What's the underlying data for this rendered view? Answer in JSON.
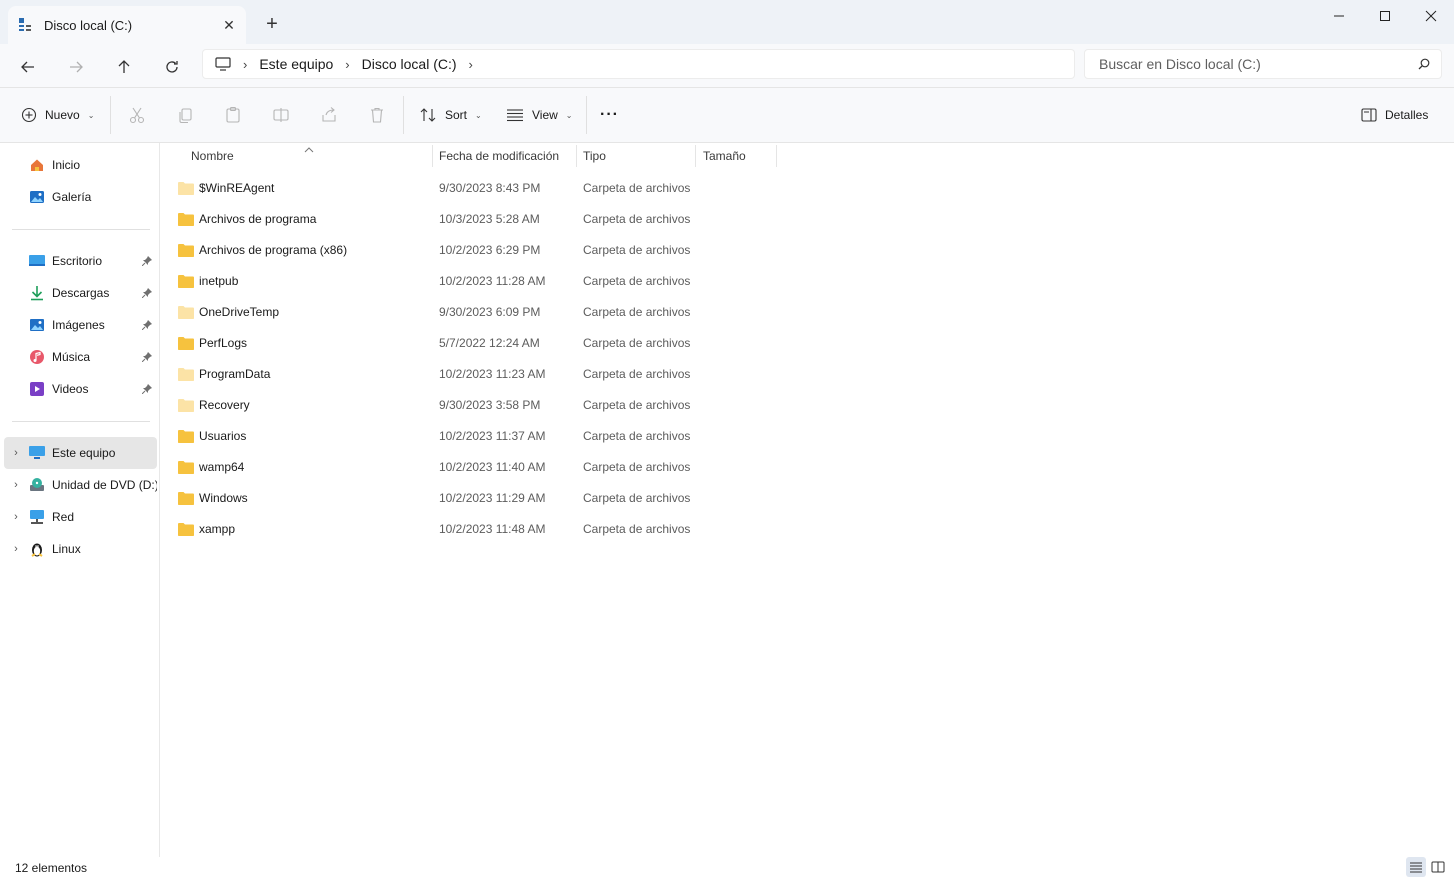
{
  "window": {
    "tab_title": "Disco local (C:)",
    "new_tab_glyph": "+",
    "minimize_icon": "minimize-icon",
    "maximize_icon": "maximize-icon",
    "close_icon": "close-icon"
  },
  "address": {
    "breadcrumbs": [
      "Este equipo",
      "Disco local (C:)"
    ],
    "search_placeholder": "Buscar en Disco local (C:)"
  },
  "toolbar": {
    "new_label": "Nuevo",
    "sort_label": "Sort",
    "view_label": "View",
    "more_label": "···",
    "details_label": "Detalles"
  },
  "sidebar": {
    "quick": [
      {
        "label": "Inicio",
        "icon": "home-icon"
      },
      {
        "label": "Galería",
        "icon": "gallery-icon"
      }
    ],
    "pinned": [
      {
        "label": "Escritorio",
        "icon": "desktop-icon"
      },
      {
        "label": "Descargas",
        "icon": "downloads-icon"
      },
      {
        "label": "Imágenes",
        "icon": "pictures-icon"
      },
      {
        "label": "Música",
        "icon": "music-icon"
      },
      {
        "label": "Videos",
        "icon": "videos-icon"
      }
    ],
    "devices": [
      {
        "label": "Este equipo",
        "icon": "this-pc-icon",
        "selected": true
      },
      {
        "label": "Unidad de DVD (D:)",
        "icon": "dvd-drive-icon"
      },
      {
        "label": "Red",
        "icon": "network-icon"
      },
      {
        "label": "Linux",
        "icon": "linux-icon"
      }
    ]
  },
  "columns": {
    "name": "Nombre",
    "modified": "Fecha de modificación",
    "type": "Tipo",
    "size": "Tamaño"
  },
  "files": [
    {
      "name": "$WinREAgent",
      "modified": "9/30/2023 8:43 PM",
      "type": "Carpeta de archivos",
      "hidden": true
    },
    {
      "name": "Archivos de programa",
      "modified": "10/3/2023 5:28 AM",
      "type": "Carpeta de archivos",
      "hidden": false
    },
    {
      "name": "Archivos de programa (x86)",
      "modified": "10/2/2023 6:29 PM",
      "type": "Carpeta de archivos",
      "hidden": false
    },
    {
      "name": "inetpub",
      "modified": "10/2/2023 11:28 AM",
      "type": "Carpeta de archivos",
      "hidden": false
    },
    {
      "name": "OneDriveTemp",
      "modified": "9/30/2023 6:09 PM",
      "type": "Carpeta de archivos",
      "hidden": true
    },
    {
      "name": "PerfLogs",
      "modified": "5/7/2022 12:24 AM",
      "type": "Carpeta de archivos",
      "hidden": false
    },
    {
      "name": "ProgramData",
      "modified": "10/2/2023 11:23 AM",
      "type": "Carpeta de archivos",
      "hidden": true
    },
    {
      "name": "Recovery",
      "modified": "9/30/2023 3:58 PM",
      "type": "Carpeta de archivos",
      "hidden": true
    },
    {
      "name": "Usuarios",
      "modified": "10/2/2023 11:37 AM",
      "type": "Carpeta de archivos",
      "hidden": false
    },
    {
      "name": "wamp64",
      "modified": "10/2/2023 11:40 AM",
      "type": "Carpeta de archivos",
      "hidden": false
    },
    {
      "name": "Windows",
      "modified": "10/2/2023 11:29 AM",
      "type": "Carpeta de archivos",
      "hidden": false
    },
    {
      "name": "xampp",
      "modified": "10/2/2023 11:48 AM",
      "type": "Carpeta de archivos",
      "hidden": false
    }
  ],
  "status": {
    "count": "12 elementos"
  },
  "colors": {
    "folder": "#f6c23e",
    "folder_hidden": "#fbe3a6",
    "accent": "#0067c0"
  }
}
